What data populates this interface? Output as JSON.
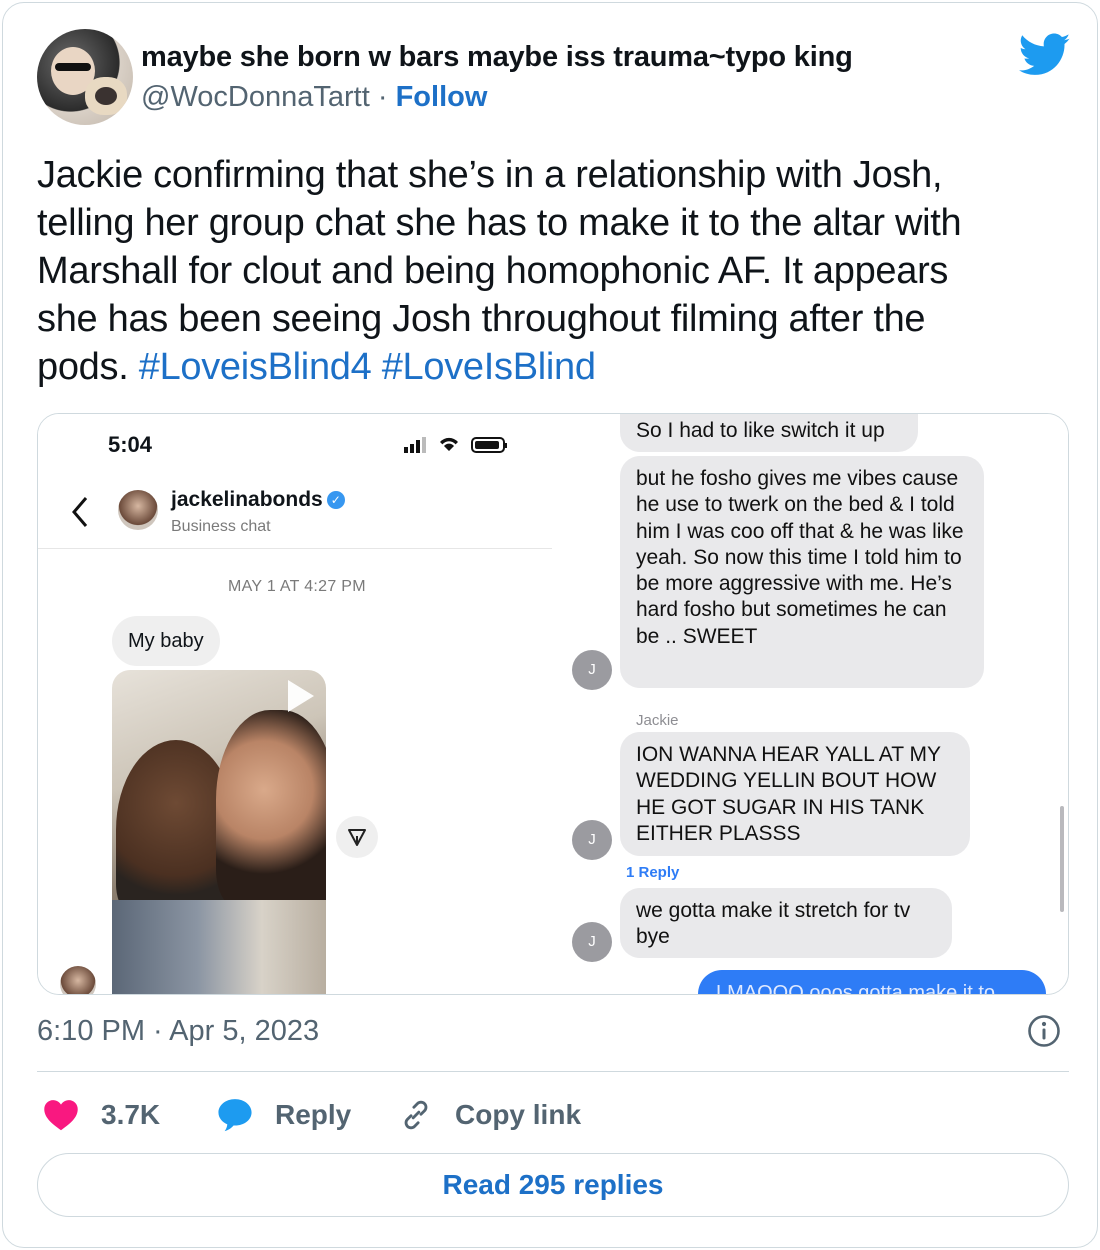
{
  "tweet": {
    "display_name": "maybe she born w bars maybe iss trauma~typo king",
    "handle": "@WocDonnaTartt",
    "dot": "·",
    "follow_label": "Follow",
    "text_lines": [
      "Jackie confirming that she’s in a relationship with Josh,",
      "telling her group chat she has to make it to the altar with",
      "Marshall for clout and being homophonic AF. It appears",
      "she has been seeing Josh throughout filming after the"
    ],
    "last_line_text": "pods.",
    "hashtags": [
      "#LoveisBlind4",
      "#LoveIsBlind"
    ],
    "timestamp": "6:10 PM · Apr 5, 2023",
    "like_count": "3.7K",
    "reply_label": "Reply",
    "copy_link_label": "Copy link",
    "read_replies_label": "Read 295 replies"
  },
  "media_left": {
    "time": "5:04",
    "username": "jackelinabonds",
    "verified_mark": "✓",
    "subtitle": "Business chat",
    "date_label": "MAY 1 AT 4:27 PM",
    "message": "My baby"
  },
  "media_right": {
    "messages": [
      {
        "text": "So I had to like switch it up"
      },
      {
        "text": "but he fosho gives me vibes cause he use to twerk on the bed & I told him I was coo off that & he was like yeah. So now this time I told him to be more aggressive with me. He’s hard fosho but sometimes he can be .. SWEET"
      },
      {
        "text": "ION WANNA HEAR YALL AT MY WEDDING YELLIN BOUT HOW HE GOT SUGAR IN HIS TANK EITHER PLASSS"
      },
      {
        "text": "we gotta make it stretch for tv bye"
      }
    ],
    "sender_label": "Jackie",
    "sender_initial": "J",
    "reply_count_label": "1 Reply",
    "outgoing_partial": "LMAOOO ooos gotta make it to"
  },
  "colors": {
    "link_blue": "#1d70c7",
    "twitter_blue": "#1d9bf0",
    "like_pink": "#f91880",
    "reply_blue": "#1d9bf0",
    "muted_gray": "#536471",
    "border": "#cfd9de",
    "imessage_gray": "#e9e9eb",
    "imessage_blue": "#2e7cf6"
  },
  "icons": {
    "logo": "twitter-bird-icon",
    "like": "heart-icon",
    "reply": "speech-bubble-icon",
    "copy": "link-icon",
    "info": "info-icon",
    "back": "chevron-left-icon",
    "share": "send-icon",
    "play": "play-icon"
  }
}
